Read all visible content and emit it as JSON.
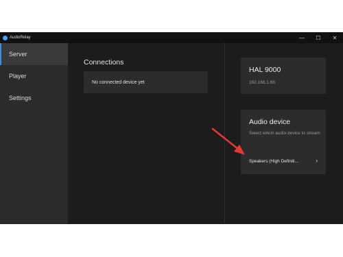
{
  "titlebar": {
    "title": "AudioRelay",
    "minimize": "—",
    "maximize": "☐",
    "close": "✕"
  },
  "sidebar": {
    "items": [
      {
        "label": "Server"
      },
      {
        "label": "Player"
      },
      {
        "label": "Settings"
      }
    ]
  },
  "connections": {
    "title": "Connections",
    "empty_text": "No connected device yet"
  },
  "server": {
    "name": "HAL 9000",
    "ip": "192.168.1.66"
  },
  "audio_device": {
    "title": "Audio device",
    "description": "Select which audio device to stream",
    "selected": "Speakers (High Definiti...",
    "chevron": "›"
  },
  "colors": {
    "accent": "#3e8fe0",
    "annotation_arrow": "#e53935"
  }
}
